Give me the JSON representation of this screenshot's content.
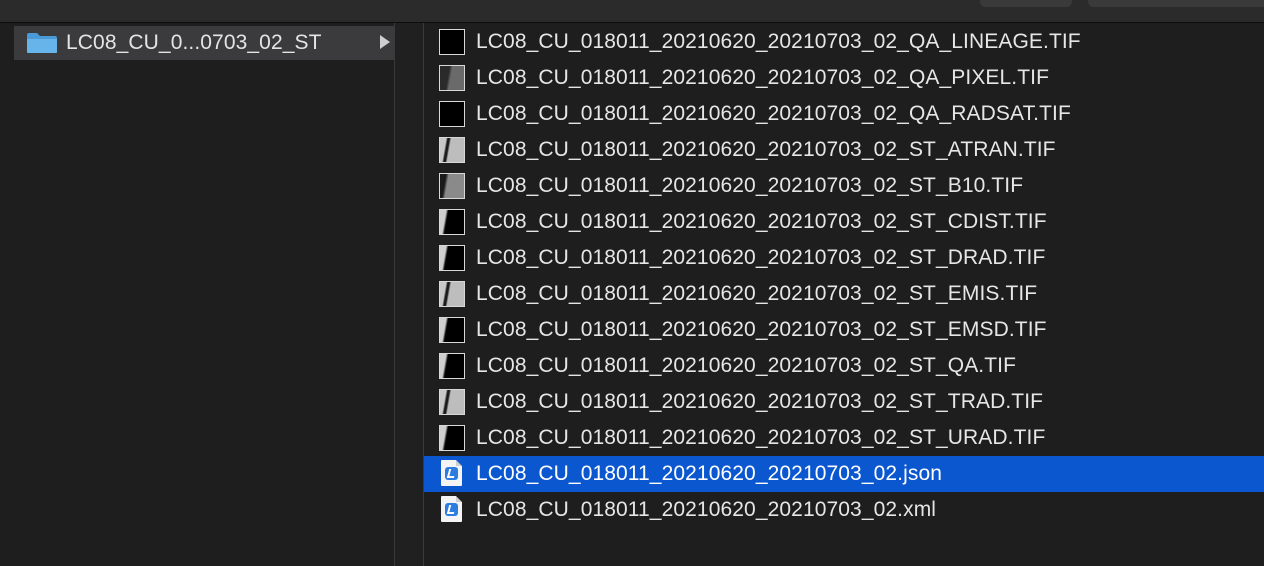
{
  "folder_column": {
    "selected_folder": "LC08_CU_0...0703_02_ST",
    "icon": "folder-icon",
    "folder_color": "#5aa9e6"
  },
  "file_column": {
    "selection_color": "#0b57d0",
    "files": [
      {
        "name": "LC08_CU_018011_20210620_20210703_02_QA_LINEAGE.TIF",
        "icon": "tif-thumbnail-icon",
        "thumb": "black"
      },
      {
        "name": "LC08_CU_018011_20210620_20210703_02_QA_PIXEL.TIF",
        "icon": "tif-thumbnail-icon",
        "thumb": "dark-grey"
      },
      {
        "name": "LC08_CU_018011_20210620_20210703_02_QA_RADSAT.TIF",
        "icon": "tif-thumbnail-icon",
        "thumb": "black"
      },
      {
        "name": "LC08_CU_018011_20210620_20210703_02_ST_ATRAN.TIF",
        "icon": "tif-thumbnail-icon",
        "thumb": "light-grey"
      },
      {
        "name": "LC08_CU_018011_20210620_20210703_02_ST_B10.TIF",
        "icon": "tif-thumbnail-icon",
        "thumb": "grey"
      },
      {
        "name": "LC08_CU_018011_20210620_20210703_02_ST_CDIST.TIF",
        "icon": "tif-thumbnail-icon",
        "thumb": "split"
      },
      {
        "name": "LC08_CU_018011_20210620_20210703_02_ST_DRAD.TIF",
        "icon": "tif-thumbnail-icon",
        "thumb": "split"
      },
      {
        "name": "LC08_CU_018011_20210620_20210703_02_ST_EMIS.TIF",
        "icon": "tif-thumbnail-icon",
        "thumb": "light-grey"
      },
      {
        "name": "LC08_CU_018011_20210620_20210703_02_ST_EMSD.TIF",
        "icon": "tif-thumbnail-icon",
        "thumb": "split"
      },
      {
        "name": "LC08_CU_018011_20210620_20210703_02_ST_QA.TIF",
        "icon": "tif-thumbnail-icon",
        "thumb": "split"
      },
      {
        "name": "LC08_CU_018011_20210620_20210703_02_ST_TRAD.TIF",
        "icon": "tif-thumbnail-icon",
        "thumb": "light-grey"
      },
      {
        "name": "LC08_CU_018011_20210620_20210703_02_ST_URAD.TIF",
        "icon": "tif-thumbnail-icon",
        "thumb": "split"
      },
      {
        "name": "LC08_CU_018011_20210620_20210703_02.json",
        "icon": "json-document-icon",
        "thumb": "doc",
        "selected": true
      },
      {
        "name": "LC08_CU_018011_20210620_20210703_02.xml",
        "icon": "xml-document-icon",
        "thumb": "doc"
      }
    ]
  }
}
